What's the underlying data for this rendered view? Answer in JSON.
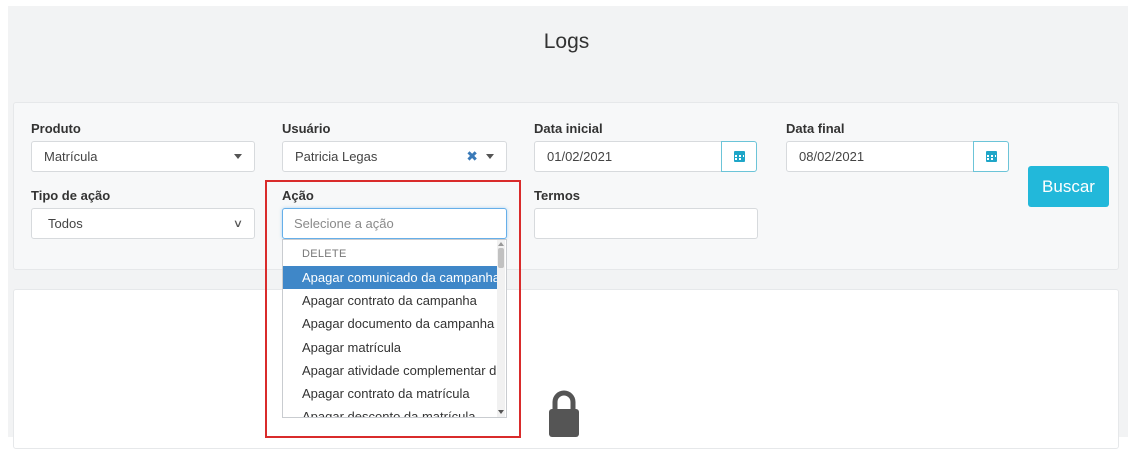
{
  "page": {
    "title": "Logs"
  },
  "filters": {
    "produto": {
      "label": "Produto",
      "value": "Matrícula"
    },
    "usuario": {
      "label": "Usuário",
      "value": "Patricia Legas",
      "clear_symbol": "✖"
    },
    "data_inicial": {
      "label": "Data inicial",
      "value": "01/02/2021"
    },
    "data_final": {
      "label": "Data final",
      "value": "08/02/2021"
    },
    "tipo_acao": {
      "label": "Tipo de ação",
      "value": "Todos"
    },
    "acao": {
      "label": "Ação",
      "placeholder": "Selecione a ação"
    },
    "termos": {
      "label": "Termos",
      "value": ""
    }
  },
  "buscar_label": "Buscar",
  "acao_dropdown": {
    "group_label": "DELETE",
    "items": [
      "Apagar comunicado da campanha",
      "Apagar contrato da campanha",
      "Apagar documento da campanha",
      "Apagar matrícula",
      "Apagar atividade complementar da",
      "Apagar contrato da matrícula",
      "Apagar desconto da matrícula"
    ],
    "selected_index": 0
  },
  "colors": {
    "accent": "#22b8da",
    "selected_item": "#3f87c8",
    "highlight_border": "#d92b2b",
    "clear_icon": "#3a7ab8"
  },
  "icons": {
    "calendar": "calendar-icon",
    "lock": "lock-icon",
    "clear": "clear-icon"
  }
}
